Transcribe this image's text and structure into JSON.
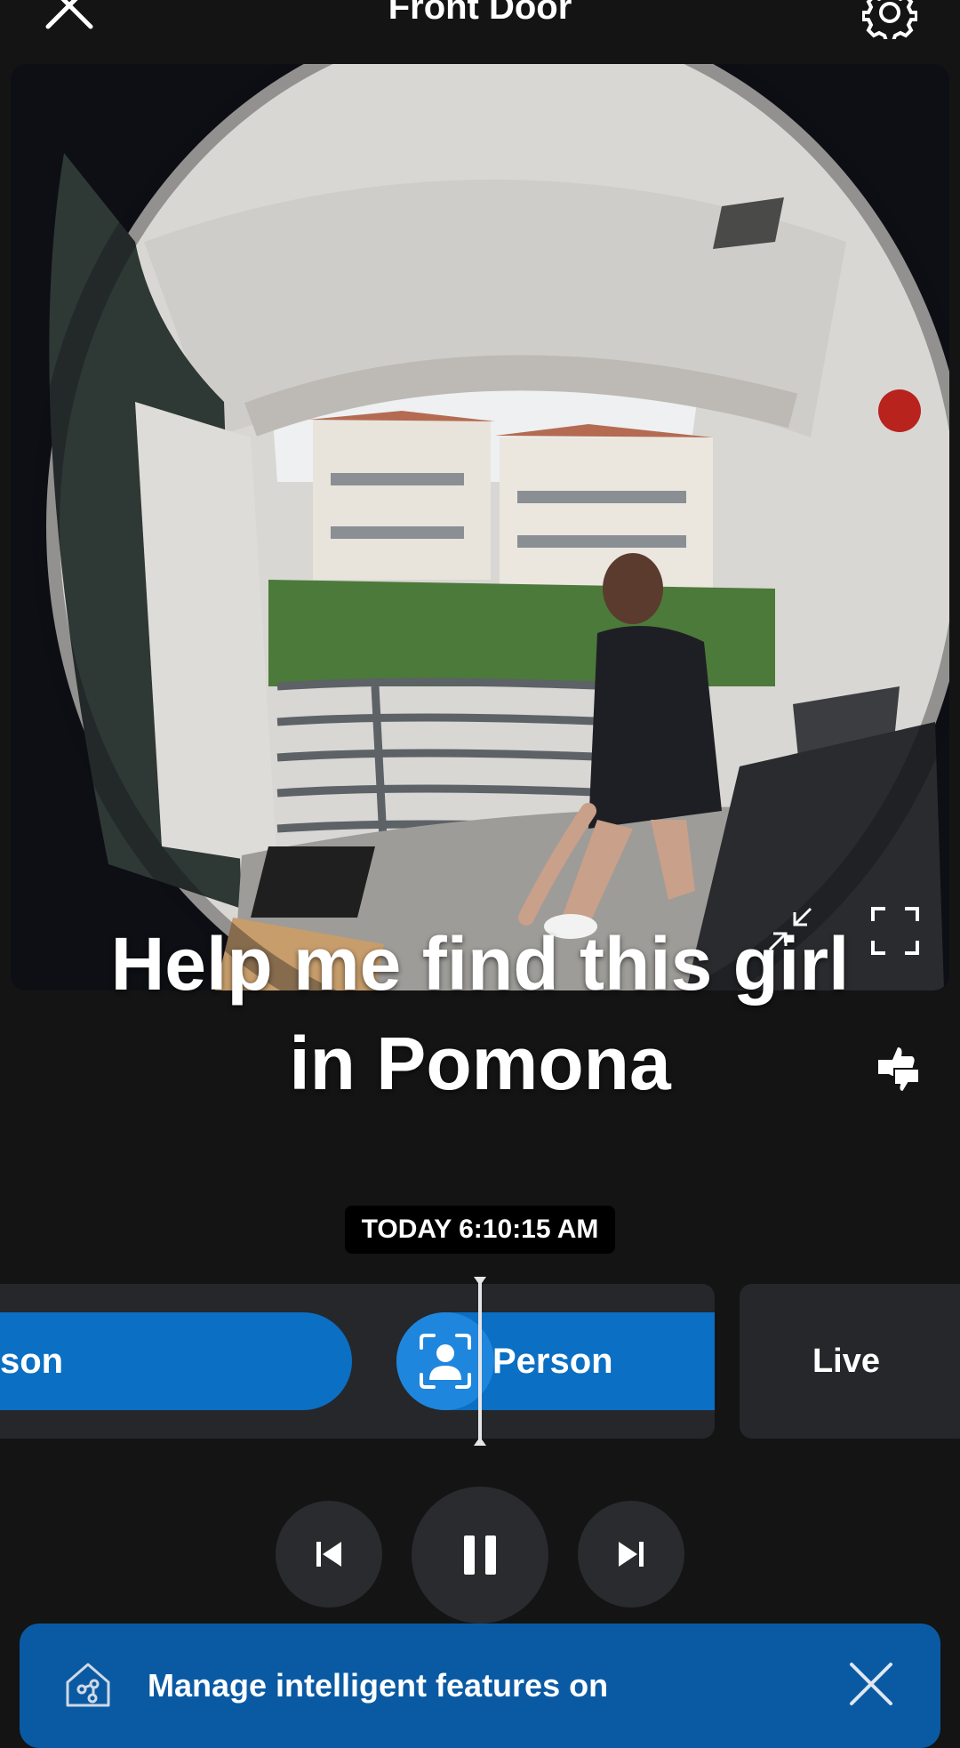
{
  "header": {
    "title": "Front Door",
    "close_icon": "close-icon",
    "settings_icon": "gear-icon"
  },
  "video": {
    "caption_line1": "Help me find this girl",
    "caption_line2": "in Pomona"
  },
  "timestamp": "TODAY 6:10:15 AM",
  "timeline": {
    "events": [
      {
        "label": "son"
      },
      {
        "label": "Person",
        "icon": "person-icon"
      }
    ],
    "live_label": "Live"
  },
  "playback": {
    "prev_icon": "skip-previous-icon",
    "pause_icon": "pause-icon",
    "next_icon": "skip-next-icon"
  },
  "banner": {
    "text": "Manage intelligent features on",
    "icon": "smart-home-icon",
    "close_icon": "close-icon"
  },
  "colors": {
    "background": "#141414",
    "accent": "#0b6fc3",
    "banner": "#0a5aa3",
    "track": "#25272b"
  }
}
